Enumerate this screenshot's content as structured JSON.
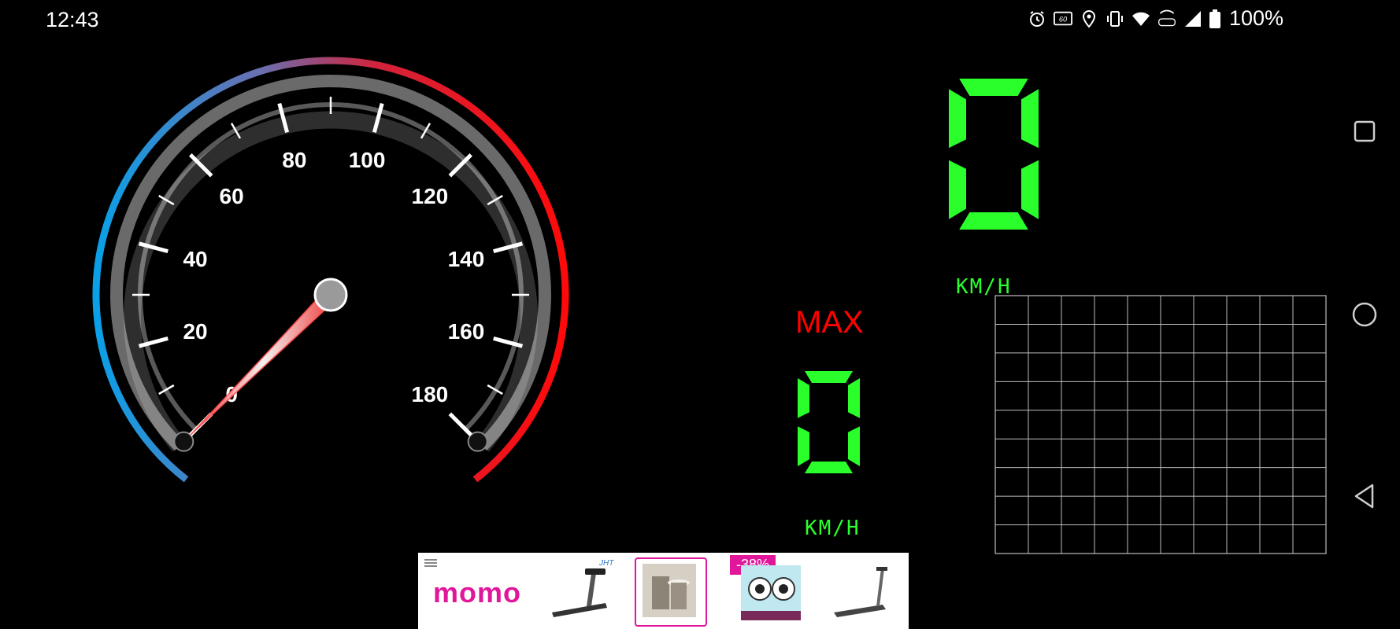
{
  "status": {
    "time": "12:43",
    "battery": "100%",
    "icons": [
      "alarm-icon",
      "refresh-rate-icon",
      "location-icon",
      "vibrate-icon",
      "wifi-icon",
      "volte-icon",
      "signal-icon",
      "battery-icon"
    ],
    "refresh_label": "60"
  },
  "speedometer": {
    "current_speed": 0,
    "min": 0,
    "max": 180,
    "tick_labels": [
      "0",
      "20",
      "40",
      "60",
      "80",
      "100",
      "120",
      "140",
      "160",
      "180"
    ],
    "colors": {
      "arc_start": "#0aa0e8",
      "arc_end": "#ff0a0a",
      "needle": "#ff6b6b"
    }
  },
  "digital": {
    "speed": "0",
    "unit": "KM/H",
    "max_label": "MAX",
    "max_speed": "0",
    "max_unit": "KM/H",
    "digit_color": "#2bff2b"
  },
  "speed_chart": {
    "columns": 10,
    "rows": 9
  },
  "nav": {
    "icons": [
      "recents-icon",
      "home-icon",
      "back-icon"
    ]
  },
  "ad": {
    "logo": "momo",
    "brand": "JHT",
    "badge": "-38%",
    "products": [
      "treadmill-image",
      "stool-image",
      "security-camera-image",
      "walking-pad-image"
    ]
  }
}
